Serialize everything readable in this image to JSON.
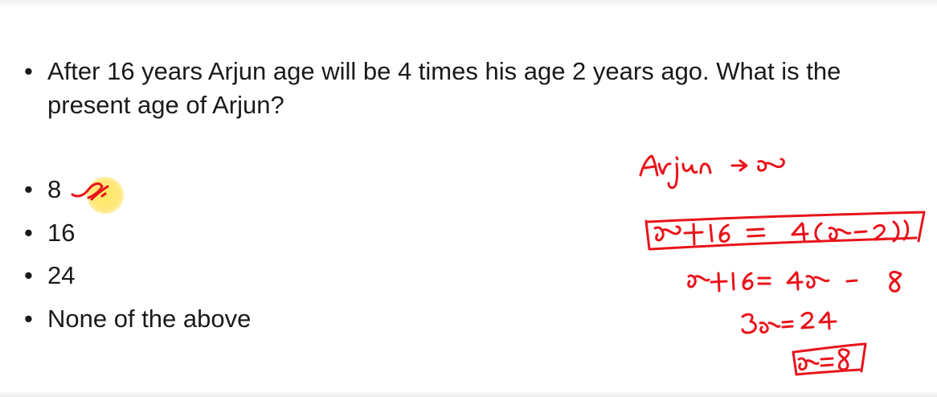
{
  "question": {
    "bullet": "•",
    "text": "After 16 years Arjun age will be 4 times his age 2 years ago. What is the present age of Arjun?"
  },
  "options": [
    {
      "bullet": "•",
      "label": "8"
    },
    {
      "bullet": "•",
      "label": "16"
    },
    {
      "bullet": "•",
      "label": "24"
    },
    {
      "bullet": "•",
      "label": "None of the above"
    }
  ],
  "handwritten_work": {
    "ink_color": "#e8141b",
    "lines": [
      "Arjun → x",
      "x+16 = 4(x−2)",
      "x+16= 4x − 8",
      "3x=24",
      "x= 8"
    ]
  },
  "annotations": {
    "selected_option_mark": "tick-mark-on-option-8",
    "cursor_highlight_color": "#ffe45a"
  }
}
